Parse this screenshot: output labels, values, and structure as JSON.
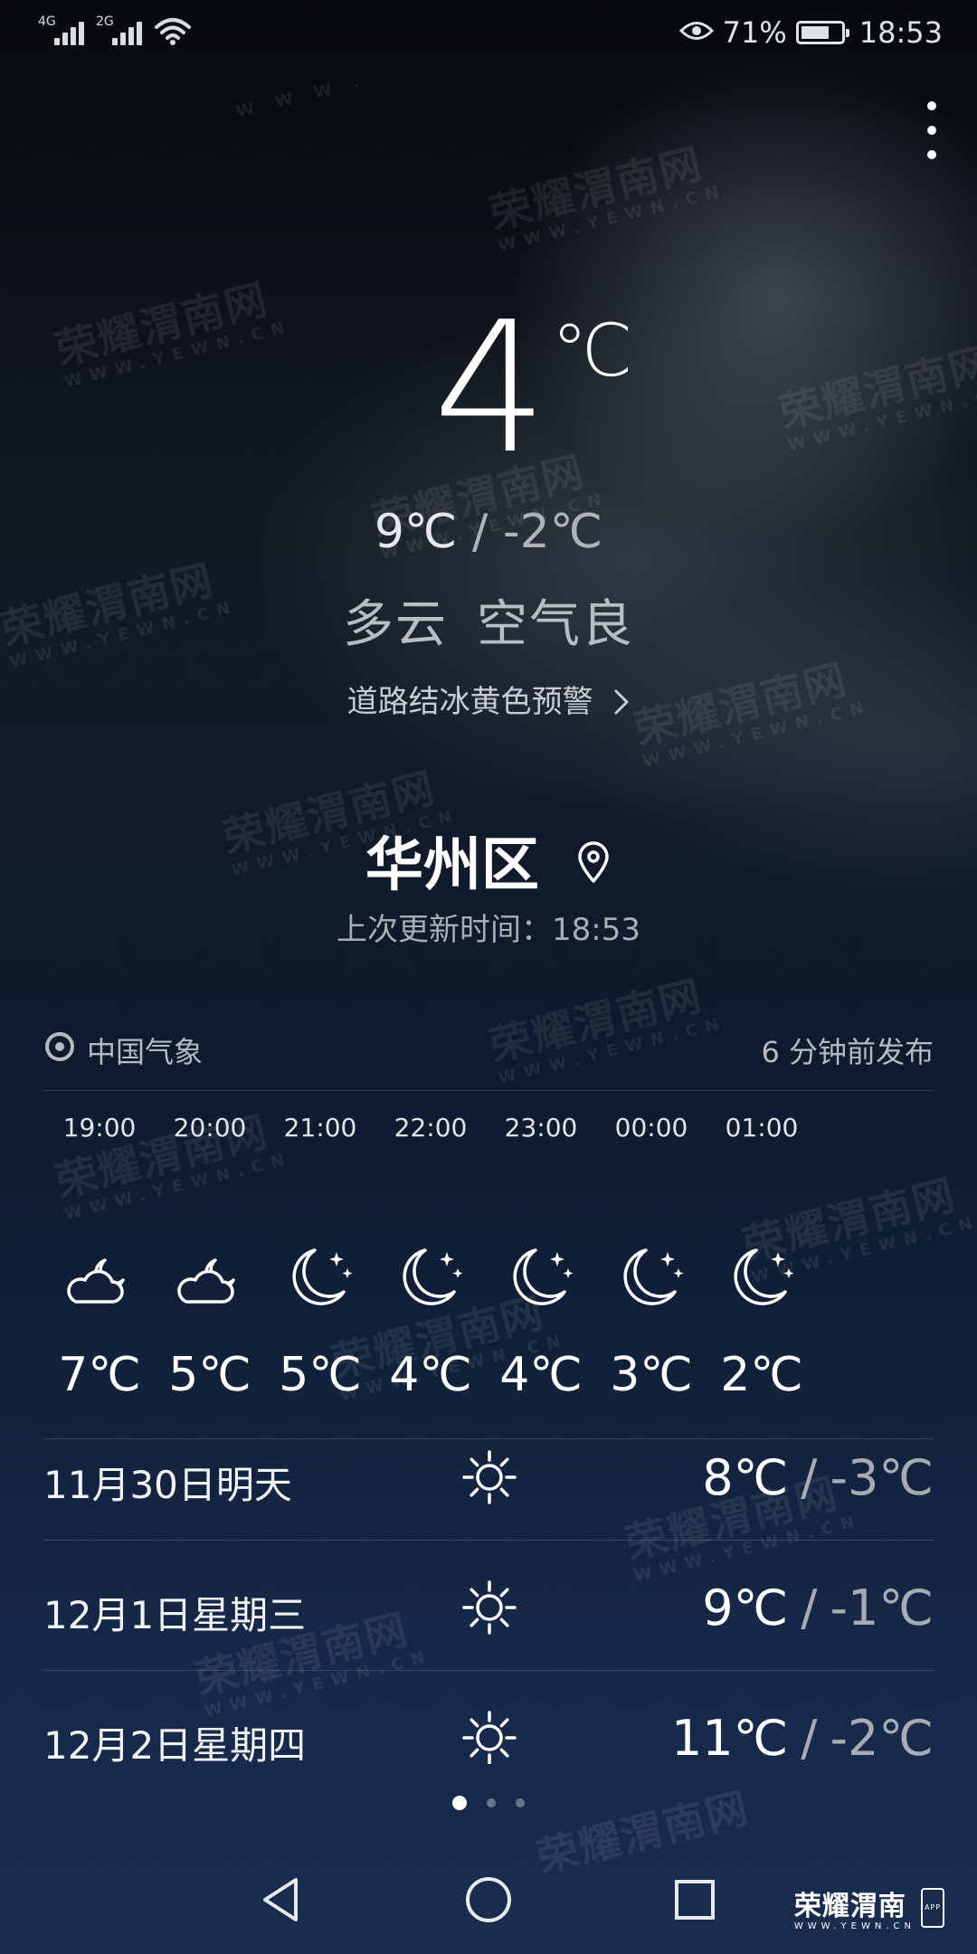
{
  "status_bar": {
    "network1": "4G",
    "network2": "2G",
    "battery_percent_text": "71%",
    "battery_level": 0.71,
    "time": "18:53"
  },
  "current": {
    "temperature": "4",
    "unit": "℃",
    "high": "9℃",
    "separator": "/",
    "low": "-2℃",
    "condition": "多云",
    "air_quality": "空气良",
    "alert": "道路结冰黄色预警",
    "city": "华州区",
    "updated_label": "上次更新时间：",
    "updated_time": "18:53"
  },
  "source": {
    "provider": "中国气象",
    "published": "6 分钟前发布"
  },
  "hourly": [
    {
      "time": "19:00",
      "icon": "partly-cloudy-night-icon",
      "temp": "7℃"
    },
    {
      "time": "20:00",
      "icon": "partly-cloudy-night-icon",
      "temp": "5℃"
    },
    {
      "time": "21:00",
      "icon": "clear-night-icon",
      "temp": "5℃"
    },
    {
      "time": "22:00",
      "icon": "clear-night-icon",
      "temp": "4℃"
    },
    {
      "time": "23:00",
      "icon": "clear-night-icon",
      "temp": "4℃"
    },
    {
      "time": "00:00",
      "icon": "clear-night-icon",
      "temp": "3℃"
    },
    {
      "time": "01:00",
      "icon": "clear-night-icon",
      "temp": "2℃"
    }
  ],
  "daily": [
    {
      "date": "11月30日明天",
      "icon": "sunny-icon",
      "high": "8℃",
      "low": "-3℃"
    },
    {
      "date": "12月1日星期三",
      "icon": "sunny-icon",
      "high": "9℃",
      "low": "-1℃"
    },
    {
      "date": "12月2日星期四",
      "icon": "sunny-icon",
      "high": "11℃",
      "low": "-2℃"
    }
  ],
  "watermark": {
    "text": "荣耀渭南网",
    "domain": "WWW.YEWN.CN"
  },
  "brand": {
    "name": "荣耀渭南",
    "domain": "WWW.YEWN.CN",
    "badge": "APP"
  },
  "pages": {
    "count": 3,
    "active": 1
  }
}
